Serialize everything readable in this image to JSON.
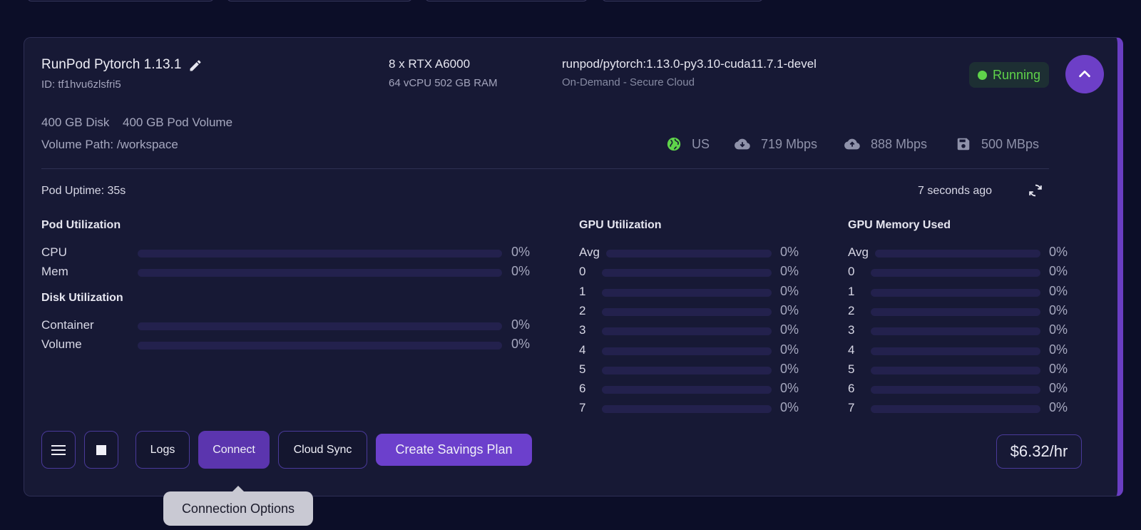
{
  "pod": {
    "name": "RunPod Pytorch 1.13.1",
    "id_text": "ID: tf1hvu6zlsfri5",
    "gpu": "8 x RTX A6000",
    "resources": "64 vCPU 502 GB RAM",
    "image": "runpod/pytorch:1.13.0-py3.10-cuda11.7.1-devel",
    "cloud": "On-Demand - Secure Cloud",
    "status": "Running",
    "disk": "400 GB Disk",
    "pod_volume": "400 GB Pod Volume",
    "volume_path": "Volume Path: /workspace"
  },
  "network": {
    "region": "US",
    "download": "719 Mbps",
    "upload": "888 Mbps",
    "disk_speed": "500 MBps"
  },
  "uptime": {
    "label": "Pod Uptime: 35s",
    "updated": "7 seconds ago"
  },
  "pod_utilization": {
    "title": "Pod Utilization",
    "rows": [
      {
        "label": "CPU",
        "value": "0%",
        "fraction": 0
      },
      {
        "label": "Mem",
        "value": "0%",
        "fraction": 0
      }
    ]
  },
  "disk_utilization": {
    "title": "Disk Utilization",
    "rows": [
      {
        "label": "Container",
        "value": "0%",
        "fraction": 0
      },
      {
        "label": "Volume",
        "value": "0%",
        "fraction": 0
      }
    ]
  },
  "gpu_utilization": {
    "title": "GPU Utilization",
    "rows": [
      {
        "label": "Avg",
        "value": "0%",
        "fraction": 0
      },
      {
        "label": "0",
        "value": "0%",
        "fraction": 0
      },
      {
        "label": "1",
        "value": "0%",
        "fraction": 0
      },
      {
        "label": "2",
        "value": "0%",
        "fraction": 0
      },
      {
        "label": "3",
        "value": "0%",
        "fraction": 0
      },
      {
        "label": "4",
        "value": "0%",
        "fraction": 0
      },
      {
        "label": "5",
        "value": "0%",
        "fraction": 0
      },
      {
        "label": "6",
        "value": "0%",
        "fraction": 0
      },
      {
        "label": "7",
        "value": "0%",
        "fraction": 0
      }
    ]
  },
  "gpu_memory": {
    "title": "GPU Memory Used",
    "rows": [
      {
        "label": "Avg",
        "value": "0%",
        "fraction": 0
      },
      {
        "label": "0",
        "value": "0%",
        "fraction": 0
      },
      {
        "label": "1",
        "value": "0%",
        "fraction": 0
      },
      {
        "label": "2",
        "value": "0%",
        "fraction": 0
      },
      {
        "label": "3",
        "value": "0%",
        "fraction": 0
      },
      {
        "label": "4",
        "value": "0%",
        "fraction": 0
      },
      {
        "label": "5",
        "value": "0%",
        "fraction": 0
      },
      {
        "label": "6",
        "value": "0%",
        "fraction": 0
      },
      {
        "label": "7",
        "value": "0%",
        "fraction": 0
      }
    ]
  },
  "actions": {
    "logs": "Logs",
    "connect": "Connect",
    "cloud_sync": "Cloud Sync",
    "savings_plan": "Create Savings Plan",
    "tooltip": "Connection Options"
  },
  "price": "$6.32/hr",
  "icons": {
    "edit": "pencil-icon",
    "collapse": "chevron-up-icon",
    "region": "globe-icon",
    "download": "cloud-download-icon",
    "upload": "cloud-upload-icon",
    "disk": "floppy-disk-icon",
    "refresh": "refresh-icon",
    "menu": "hamburger-menu-icon",
    "stop": "stop-icon"
  },
  "colors": {
    "accent": "#6d3fc7",
    "running": "#5fd34a",
    "background": "#0c0e28",
    "card": "#171935"
  }
}
